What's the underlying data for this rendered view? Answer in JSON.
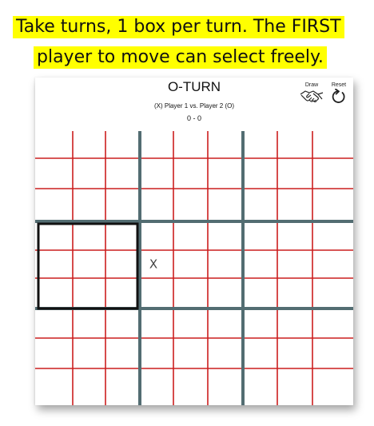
{
  "instructions": {
    "line1": "Take turns, 1 box per turn. The FIRST",
    "line2": "player to move can select freely."
  },
  "header": {
    "title": "O-TURN",
    "players": "(X) Player 1 vs. Player 2 (O)",
    "score": "0  -  0"
  },
  "controls": {
    "draw_label": "Draw",
    "draw_icon": "handshake-icon",
    "reset_label": "Reset",
    "reset_icon": "reset-arrow-icon"
  },
  "board": {
    "size": 9,
    "marks": [
      {
        "row": 4,
        "col": 3,
        "symbol": "X"
      }
    ],
    "active_block": {
      "block_row": 1,
      "block_col": 0
    }
  },
  "colors": {
    "banner_bg": "#ffff00",
    "cell_line": "#cc1e1e",
    "block_line": "#536d72",
    "active_block_border": "#111111",
    "mark_text": "#444444"
  }
}
